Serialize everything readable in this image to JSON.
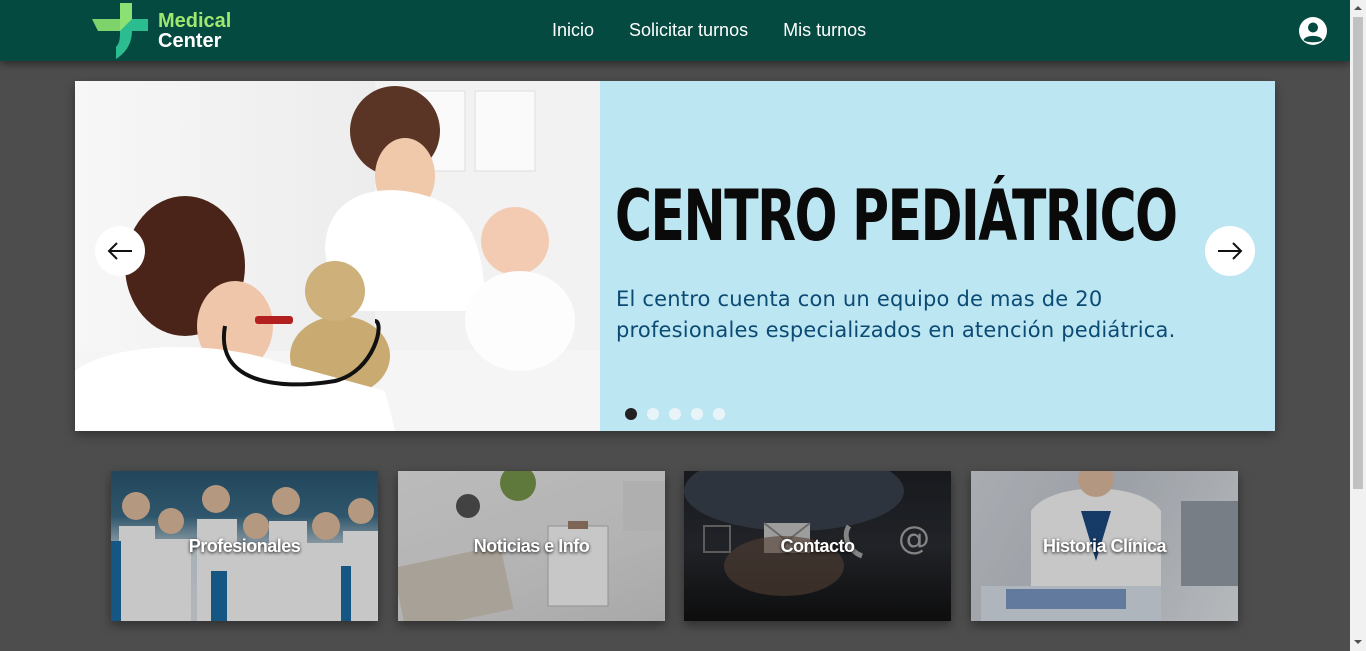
{
  "brand": {
    "line1": "Medical",
    "line2": "Center"
  },
  "nav": {
    "items": [
      "Inicio",
      "Solicitar turnos",
      "Mis turnos"
    ]
  },
  "carousel": {
    "title": "CENTRO PEDIÁTRICO",
    "description": "El centro cuenta con un equipo de mas de 20 profesionales especializados en atención pediátrica.",
    "slide_count": 5,
    "active_slide": 1
  },
  "cards": [
    {
      "label": "Profesionales"
    },
    {
      "label": "Noticias e Info"
    },
    {
      "label": "Contacto"
    },
    {
      "label": "Historia Clínica"
    }
  ],
  "colors": {
    "navbar": "#054a40",
    "page_bg": "#4d4d4d",
    "slide_bg": "#bde6f3",
    "logo_green": "#9fe870",
    "slide_desc": "#0b4a73"
  },
  "icons": [
    "logo-icon",
    "user-account-icon",
    "arrow-left-icon",
    "arrow-right-icon"
  ]
}
